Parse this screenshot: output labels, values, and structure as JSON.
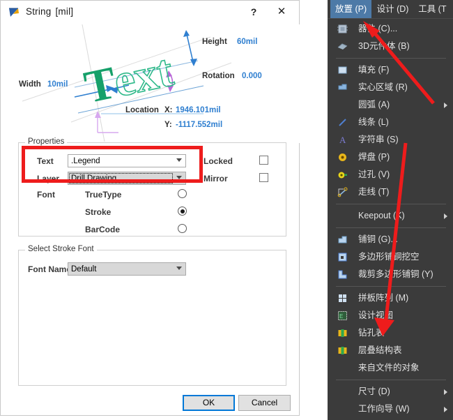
{
  "dialog": {
    "title": "String",
    "unit": "[mil]",
    "help_label": "?",
    "close_label": "✕",
    "icon": "altium-string-icon",
    "preview": {
      "sample_text": "Text",
      "height_label": "Height",
      "height_value": "60mil",
      "rotation_label": "Rotation",
      "rotation_value": "0.000",
      "width_label": "Width",
      "width_value": "10mil",
      "location_label": "Location",
      "location_x_label": "X:",
      "location_x_value": "1946.101mil",
      "location_y_label": "Y:",
      "location_y_value": "-1117.552mil"
    },
    "properties": {
      "group_title": "Properties",
      "text_label": "Text",
      "text_value": ".Legend",
      "layer_label": "Layer",
      "layer_value": "Drill Drawing",
      "locked_label": "Locked",
      "locked_checked": false,
      "mirror_label": "Mirror",
      "mirror_checked": false,
      "font_label": "Font",
      "font_options": [
        {
          "label": "TrueType",
          "selected": false
        },
        {
          "label": "Stroke",
          "selected": true
        },
        {
          "label": "BarCode",
          "selected": false
        }
      ]
    },
    "stroke_font": {
      "group_title": "Select Stroke Font",
      "font_name_label": "Font Name",
      "font_name_value": "Default"
    },
    "buttons": {
      "ok": "OK",
      "cancel": "Cancel"
    }
  },
  "menu": {
    "menubar": [
      {
        "label": "放置 (P)",
        "active": true
      },
      {
        "label": "设计 (D)",
        "active": false
      },
      {
        "label": "工具 (T",
        "active": false
      }
    ],
    "items": [
      {
        "label": "器件 (C)...",
        "icon": "component-icon",
        "submenu": false,
        "separator_after": false
      },
      {
        "label": "3D元件体 (B)",
        "icon": "body3d-icon",
        "submenu": false,
        "separator_after": true
      },
      {
        "label": "填充 (F)",
        "icon": "fill-icon",
        "submenu": false,
        "separator_after": false
      },
      {
        "label": "实心区域 (R)",
        "icon": "solid-region-icon",
        "submenu": false,
        "separator_after": false
      },
      {
        "label": "圆弧 (A)",
        "icon": "none",
        "submenu": true,
        "separator_after": false
      },
      {
        "label": "线条 (L)",
        "icon": "line-icon",
        "submenu": false,
        "separator_after": false
      },
      {
        "label": "字符串 (S)",
        "icon": "string-icon",
        "submenu": false,
        "separator_after": false
      },
      {
        "label": "焊盘 (P)",
        "icon": "pad-icon",
        "submenu": false,
        "separator_after": false
      },
      {
        "label": "过孔 (V)",
        "icon": "via-icon",
        "submenu": false,
        "separator_after": false
      },
      {
        "label": "走线 (T)",
        "icon": "track-icon",
        "submenu": false,
        "separator_after": true
      },
      {
        "label": "Keepout (K)",
        "icon": "none",
        "submenu": true,
        "separator_after": true
      },
      {
        "label": "铺铜 (G)...",
        "icon": "polygon-icon",
        "submenu": false,
        "separator_after": false
      },
      {
        "label": "多边形铺铜挖空",
        "icon": "polygon-cutout-icon",
        "submenu": false,
        "separator_after": false
      },
      {
        "label": "裁剪多边形铺铜 (Y)",
        "icon": "polygon-slice-icon",
        "submenu": false,
        "separator_after": true
      },
      {
        "label": "拼板阵列 (M)",
        "icon": "panel-array-icon",
        "submenu": false,
        "separator_after": false
      },
      {
        "label": "设计视图",
        "icon": "design-view-icon",
        "submenu": false,
        "separator_after": false
      },
      {
        "label": "钻孔表",
        "icon": "drill-table-icon",
        "submenu": false,
        "separator_after": false
      },
      {
        "label": "层叠结构表",
        "icon": "layer-stack-table-icon",
        "submenu": false,
        "separator_after": false
      },
      {
        "label": "来自文件的对象",
        "icon": "none",
        "submenu": false,
        "separator_after": true
      },
      {
        "label": "尺寸 (D)",
        "icon": "none",
        "submenu": true,
        "separator_after": false
      },
      {
        "label": "工作向导 (W)",
        "icon": "none",
        "submenu": true,
        "separator_after": false
      }
    ]
  },
  "annotations": {
    "highlight_color": "#ee1c1c",
    "arrow_color": "#ee1c1c",
    "arrow_count": 2
  },
  "colors": {
    "accent_blue": "#2f7fd0",
    "preview_green": "#16a06a",
    "menu_background": "#3b3b3b",
    "menu_highlight": "#4d7aa7",
    "dialog_background": "#ffffff"
  }
}
